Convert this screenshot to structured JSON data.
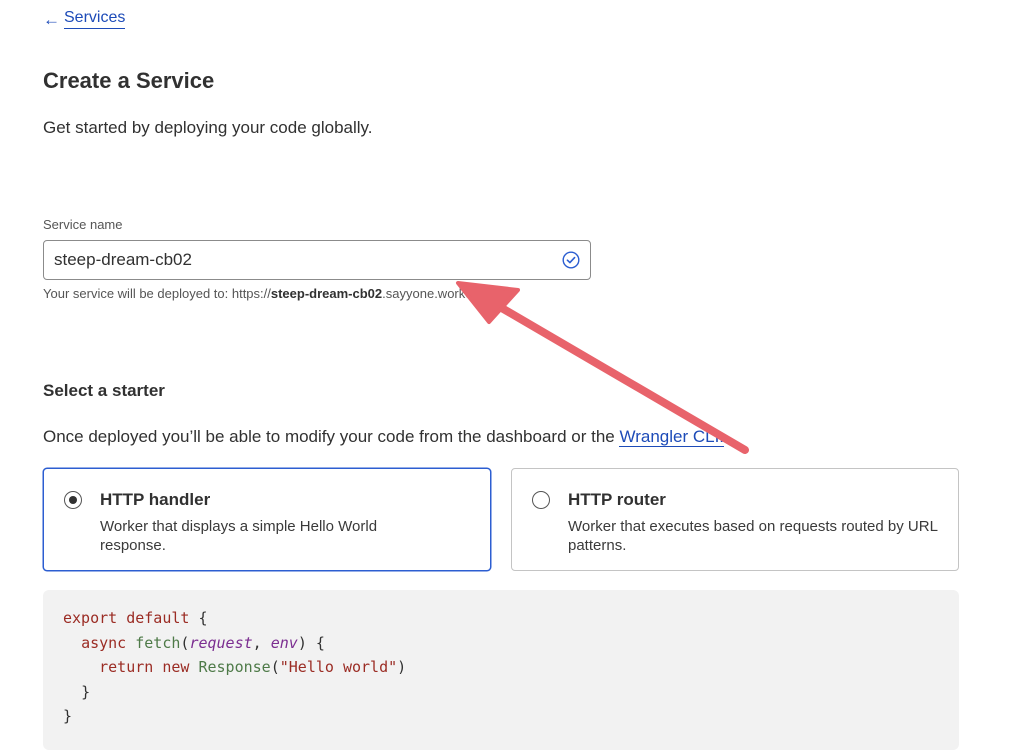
{
  "nav": {
    "back_label": "Services"
  },
  "page": {
    "title": "Create a Service",
    "subtitle": "Get started by deploying your code globally."
  },
  "service_name": {
    "label": "Service name",
    "value": "steep-dream-cb02",
    "hint_prefix": "Your service will be deployed to: https://",
    "hint_name": "steep-dream-cb02",
    "hint_suffix": ".sayyone.workers.dev"
  },
  "starter": {
    "title": "Select a starter",
    "description": "Once deployed you’ll be able to modify your code from the dashboard or the ",
    "link_label": "Wrangler CLI.",
    "options": [
      {
        "title": "HTTP handler",
        "description": "Worker that displays a simple Hello World response.",
        "selected": true
      },
      {
        "title": "HTTP router",
        "description": "Worker that executes based on requests routed by URL patterns.",
        "selected": false
      }
    ]
  },
  "code": {
    "kw_export": "export",
    "kw_default": "default",
    "brace_open": "{",
    "kw_async": "async",
    "fn_fetch": "fetch",
    "param_request": "request",
    "param_env": "env",
    "kw_return": "return",
    "kw_new": "new",
    "fn_response": "Response",
    "str_hello": "\"Hello world\"",
    "brace_close": "}"
  },
  "colors": {
    "link": "#1d4bb8",
    "selected_border": "#2c5ed1",
    "valid_check": "#2c5ed1",
    "annotation_arrow": "#e8636b",
    "code_bg": "#f2f2f2"
  }
}
